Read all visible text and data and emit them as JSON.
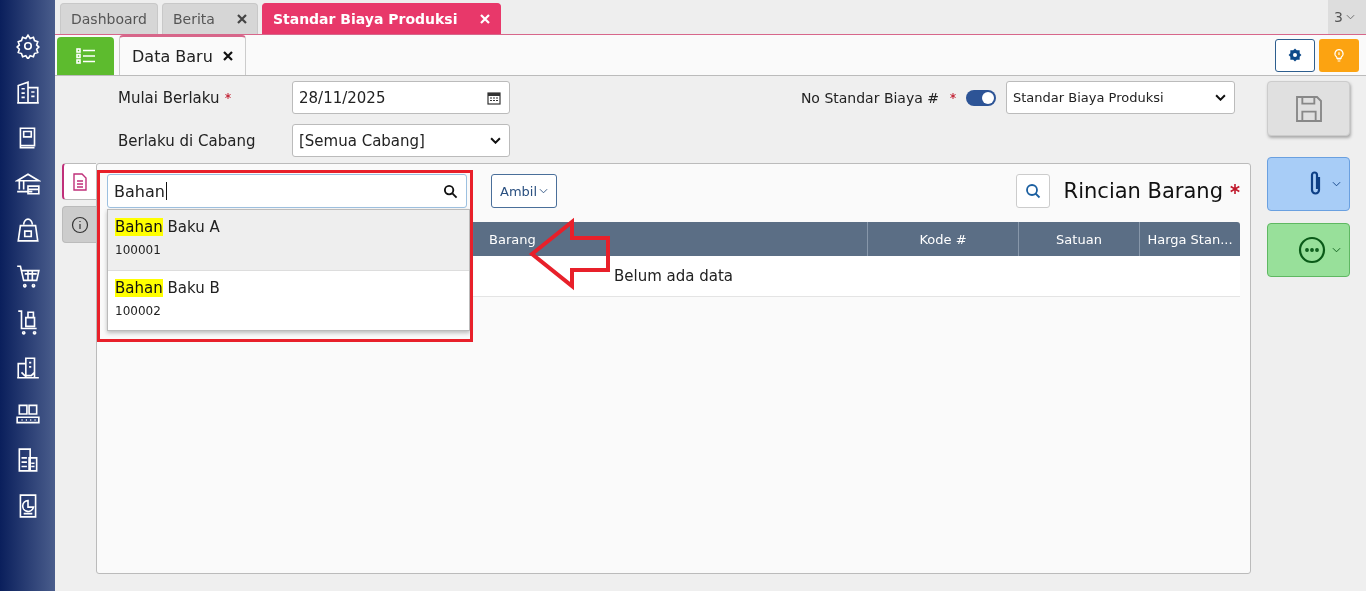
{
  "tabs": [
    {
      "label": "Dashboard",
      "selected": false,
      "closable": false
    },
    {
      "label": "Berita",
      "selected": false,
      "closable": true
    },
    {
      "label": "Standar Biaya Produksi",
      "selected": true,
      "closable": true
    }
  ],
  "tab_overflow": {
    "count": "3"
  },
  "subtabs": [
    {
      "label": "Data Baru",
      "selected": true,
      "closable": true
    }
  ],
  "form": {
    "start_date": {
      "label": "Mulai Berlaku",
      "required": true,
      "value": "28/11/2025"
    },
    "branch": {
      "label": "Berlaku di Cabang",
      "required": false,
      "value": "[Semua Cabang]"
    },
    "number": {
      "label": "No Standar Biaya #",
      "required": true,
      "auto_number": true,
      "value": "Standar Biaya Produksi"
    }
  },
  "side_tabs": [
    {
      "kind": "document",
      "selected": true
    },
    {
      "kind": "info",
      "selected": false
    }
  ],
  "details": {
    "title": "Rincian Barang",
    "required": true,
    "search": {
      "value": "Bahan"
    },
    "take_button": "Ambil",
    "columns": [
      "Barang",
      "Kode #",
      "Satuan",
      "Harga Stan..."
    ],
    "empty_text": "Belum ada data",
    "suggestions": [
      {
        "highlight": "Bahan",
        "rest": "Baku A",
        "code": "100001",
        "selected": true
      },
      {
        "highlight": "Bahan",
        "rest": "Baku B",
        "code": "100002",
        "selected": false
      }
    ]
  },
  "annotation": {
    "highlight_box": true,
    "arrow": true
  }
}
